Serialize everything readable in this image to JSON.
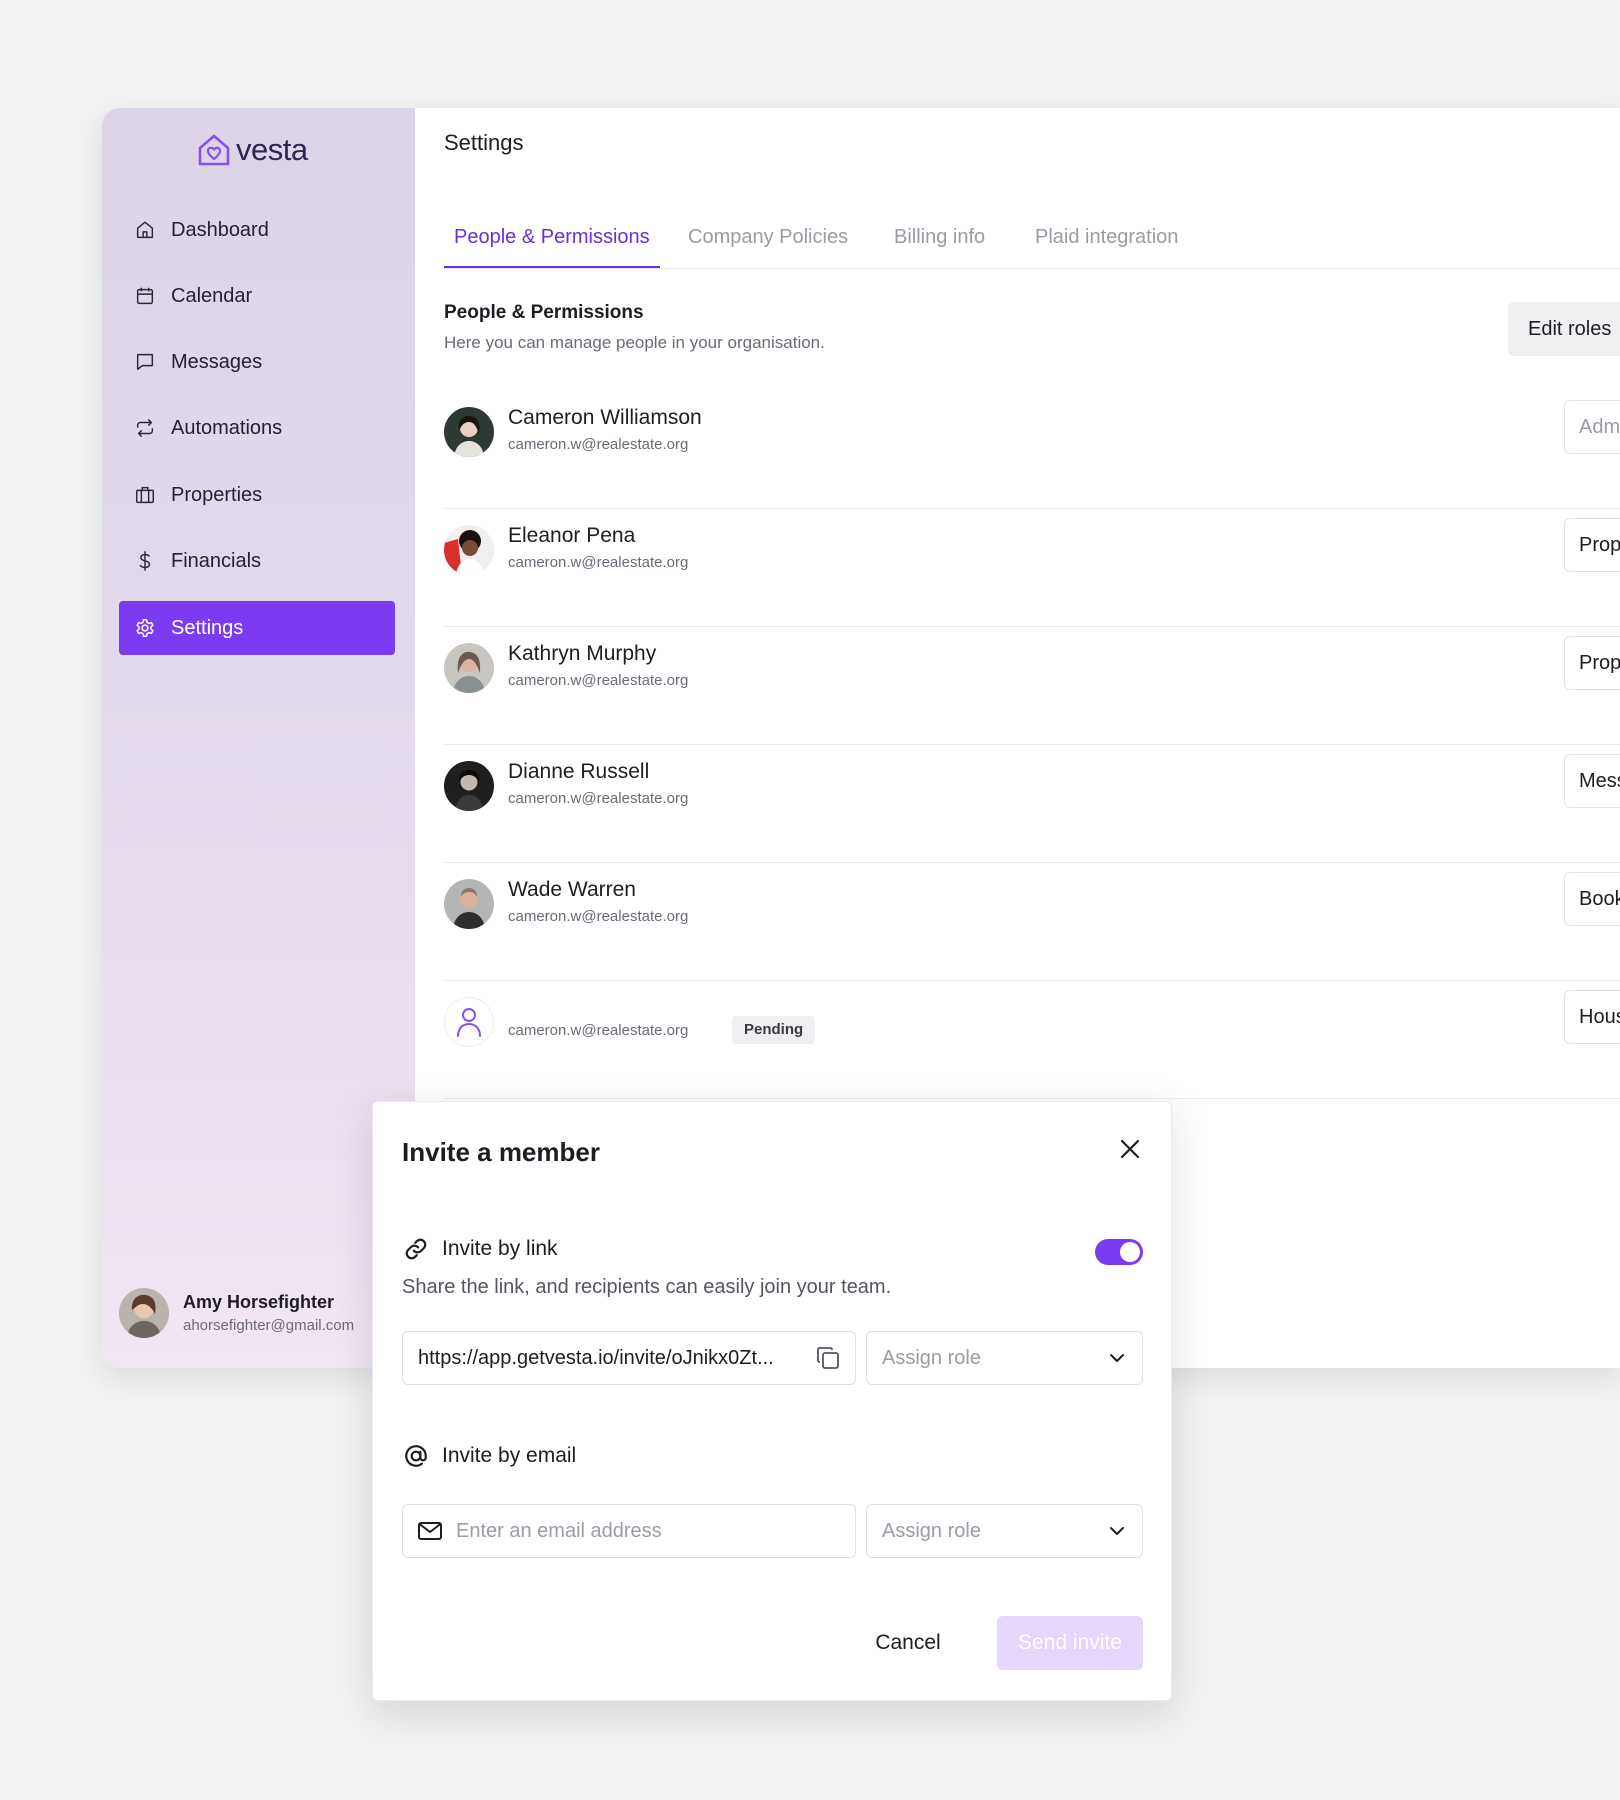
{
  "brand": {
    "name": "vesta",
    "accent": "#7a3bf1"
  },
  "sidebar": {
    "items": [
      {
        "label": "Dashboard",
        "icon": "home-icon"
      },
      {
        "label": "Calendar",
        "icon": "calendar-icon"
      },
      {
        "label": "Messages",
        "icon": "message-icon"
      },
      {
        "label": "Automations",
        "icon": "repeat-icon"
      },
      {
        "label": "Properties",
        "icon": "building-icon"
      },
      {
        "label": "Financials",
        "icon": "dollar-icon"
      },
      {
        "label": "Settings",
        "icon": "gear-icon",
        "active": true
      }
    ],
    "user": {
      "name": "Amy Horsefighter",
      "email": "ahorsefighter@gmail.com"
    }
  },
  "main": {
    "title": "Settings",
    "tabs": [
      {
        "label": "People & Permissions",
        "active": true
      },
      {
        "label": "Company Policies"
      },
      {
        "label": "Billing info"
      },
      {
        "label": "Plaid integration"
      }
    ],
    "section": {
      "title": "People & Permissions",
      "subtitle": "Here you can manage people in your organisation.",
      "edit_roles_label": "Edit roles"
    },
    "people": [
      {
        "name": "Cameron Williamson",
        "email": "cameron.w@realestate.org",
        "role": "Admin"
      },
      {
        "name": "Eleanor Pena",
        "email": "cameron.w@realestate.org",
        "role": "Propert"
      },
      {
        "name": "Kathryn Murphy",
        "email": "cameron.w@realestate.org",
        "role": "Propert"
      },
      {
        "name": "Dianne Russell",
        "email": "cameron.w@realestate.org",
        "role": "Messag"
      },
      {
        "name": "Wade Warren",
        "email": "cameron.w@realestate.org",
        "role": "Bookke"
      }
    ],
    "pending": {
      "email": "cameron.w@realestate.org",
      "badge": "Pending",
      "role": "Housek"
    }
  },
  "modal": {
    "title": "Invite a member",
    "link": {
      "heading": "Invite by link",
      "description": "Share the link, and recipients can easily join your team.",
      "url": "https://app.getvesta.io/invite/oJnikx0Zt...",
      "role_placeholder": "Assign role",
      "enabled": true
    },
    "email": {
      "heading": "Invite by email",
      "placeholder": "Enter an email address",
      "role_placeholder": "Assign role"
    },
    "cancel_label": "Cancel",
    "send_label": "Send invite"
  }
}
